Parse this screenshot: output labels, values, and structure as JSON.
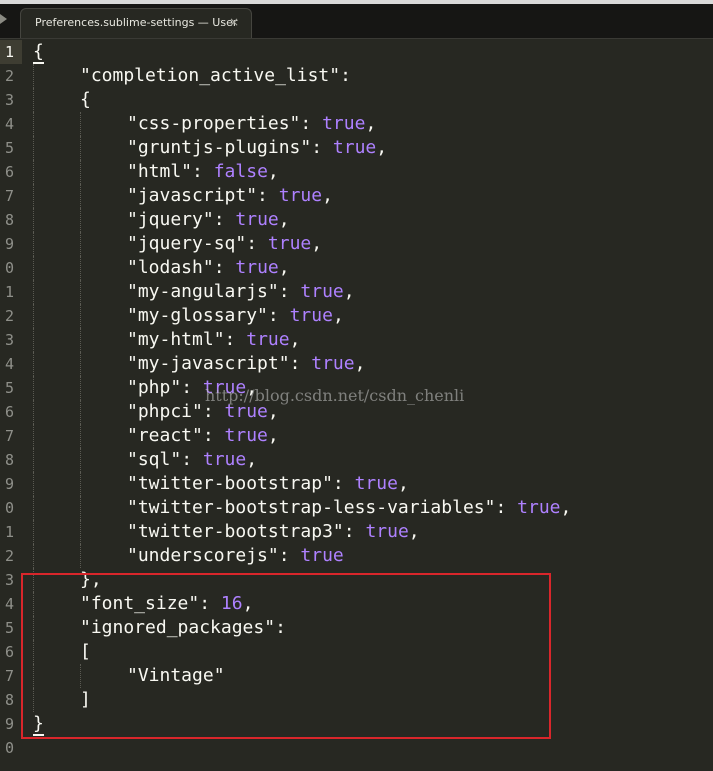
{
  "tab": {
    "title": "Preferences.sublime-settings — User",
    "close": "×"
  },
  "gutter": [
    "1",
    "2",
    "3",
    "4",
    "5",
    "6",
    "7",
    "8",
    "9",
    "0",
    "1",
    "2",
    "3",
    "4",
    "5",
    "6",
    "7",
    "8",
    "9",
    "0",
    "1",
    "2",
    "3",
    "4",
    "5",
    "6",
    "7",
    "8",
    "9",
    "0"
  ],
  "lines": [
    {
      "indent": 0,
      "tokens": [
        {
          "t": "{",
          "c": "punc bracket-hl"
        }
      ]
    },
    {
      "indent": 1,
      "tokens": [
        {
          "t": "\"completion_active_list\"",
          "c": "str"
        },
        {
          "t": ":",
          "c": "punc"
        }
      ]
    },
    {
      "indent": 1,
      "tokens": [
        {
          "t": "{",
          "c": "punc"
        }
      ]
    },
    {
      "indent": 2,
      "tokens": [
        {
          "t": "\"css-properties\"",
          "c": "str"
        },
        {
          "t": ": ",
          "c": "punc"
        },
        {
          "t": "true",
          "c": "bool"
        },
        {
          "t": ",",
          "c": "punc"
        }
      ]
    },
    {
      "indent": 2,
      "tokens": [
        {
          "t": "\"gruntjs-plugins\"",
          "c": "str"
        },
        {
          "t": ": ",
          "c": "punc"
        },
        {
          "t": "true",
          "c": "bool"
        },
        {
          "t": ",",
          "c": "punc"
        }
      ]
    },
    {
      "indent": 2,
      "tokens": [
        {
          "t": "\"html\"",
          "c": "str"
        },
        {
          "t": ": ",
          "c": "punc"
        },
        {
          "t": "false",
          "c": "bool"
        },
        {
          "t": ",",
          "c": "punc"
        }
      ]
    },
    {
      "indent": 2,
      "tokens": [
        {
          "t": "\"javascript\"",
          "c": "str"
        },
        {
          "t": ": ",
          "c": "punc"
        },
        {
          "t": "true",
          "c": "bool"
        },
        {
          "t": ",",
          "c": "punc"
        }
      ]
    },
    {
      "indent": 2,
      "tokens": [
        {
          "t": "\"jquery\"",
          "c": "str"
        },
        {
          "t": ": ",
          "c": "punc"
        },
        {
          "t": "true",
          "c": "bool"
        },
        {
          "t": ",",
          "c": "punc"
        }
      ]
    },
    {
      "indent": 2,
      "tokens": [
        {
          "t": "\"jquery-sq\"",
          "c": "str"
        },
        {
          "t": ": ",
          "c": "punc"
        },
        {
          "t": "true",
          "c": "bool"
        },
        {
          "t": ",",
          "c": "punc"
        }
      ]
    },
    {
      "indent": 2,
      "tokens": [
        {
          "t": "\"lodash\"",
          "c": "str"
        },
        {
          "t": ": ",
          "c": "punc"
        },
        {
          "t": "true",
          "c": "bool"
        },
        {
          "t": ",",
          "c": "punc"
        }
      ]
    },
    {
      "indent": 2,
      "tokens": [
        {
          "t": "\"my-angularjs\"",
          "c": "str"
        },
        {
          "t": ": ",
          "c": "punc"
        },
        {
          "t": "true",
          "c": "bool"
        },
        {
          "t": ",",
          "c": "punc"
        }
      ]
    },
    {
      "indent": 2,
      "tokens": [
        {
          "t": "\"my-glossary\"",
          "c": "str"
        },
        {
          "t": ": ",
          "c": "punc"
        },
        {
          "t": "true",
          "c": "bool"
        },
        {
          "t": ",",
          "c": "punc"
        }
      ]
    },
    {
      "indent": 2,
      "tokens": [
        {
          "t": "\"my-html\"",
          "c": "str"
        },
        {
          "t": ": ",
          "c": "punc"
        },
        {
          "t": "true",
          "c": "bool"
        },
        {
          "t": ",",
          "c": "punc"
        }
      ]
    },
    {
      "indent": 2,
      "tokens": [
        {
          "t": "\"my-javascript\"",
          "c": "str"
        },
        {
          "t": ": ",
          "c": "punc"
        },
        {
          "t": "true",
          "c": "bool"
        },
        {
          "t": ",",
          "c": "punc"
        }
      ]
    },
    {
      "indent": 2,
      "tokens": [
        {
          "t": "\"php\"",
          "c": "str"
        },
        {
          "t": ": ",
          "c": "punc"
        },
        {
          "t": "true",
          "c": "bool"
        },
        {
          "t": ",",
          "c": "punc"
        }
      ]
    },
    {
      "indent": 2,
      "tokens": [
        {
          "t": "\"phpci\"",
          "c": "str"
        },
        {
          "t": ": ",
          "c": "punc"
        },
        {
          "t": "true",
          "c": "bool"
        },
        {
          "t": ",",
          "c": "punc"
        }
      ]
    },
    {
      "indent": 2,
      "tokens": [
        {
          "t": "\"react\"",
          "c": "str"
        },
        {
          "t": ": ",
          "c": "punc"
        },
        {
          "t": "true",
          "c": "bool"
        },
        {
          "t": ",",
          "c": "punc"
        }
      ]
    },
    {
      "indent": 2,
      "tokens": [
        {
          "t": "\"sql\"",
          "c": "str"
        },
        {
          "t": ": ",
          "c": "punc"
        },
        {
          "t": "true",
          "c": "bool"
        },
        {
          "t": ",",
          "c": "punc"
        }
      ]
    },
    {
      "indent": 2,
      "tokens": [
        {
          "t": "\"twitter-bootstrap\"",
          "c": "str"
        },
        {
          "t": ": ",
          "c": "punc"
        },
        {
          "t": "true",
          "c": "bool"
        },
        {
          "t": ",",
          "c": "punc"
        }
      ]
    },
    {
      "indent": 2,
      "tokens": [
        {
          "t": "\"twitter-bootstrap-less-variables\"",
          "c": "str"
        },
        {
          "t": ": ",
          "c": "punc"
        },
        {
          "t": "true",
          "c": "bool"
        },
        {
          "t": ",",
          "c": "punc"
        }
      ]
    },
    {
      "indent": 2,
      "tokens": [
        {
          "t": "\"twitter-bootstrap3\"",
          "c": "str"
        },
        {
          "t": ": ",
          "c": "punc"
        },
        {
          "t": "true",
          "c": "bool"
        },
        {
          "t": ",",
          "c": "punc"
        }
      ]
    },
    {
      "indent": 2,
      "tokens": [
        {
          "t": "\"underscorejs\"",
          "c": "str"
        },
        {
          "t": ": ",
          "c": "punc"
        },
        {
          "t": "true",
          "c": "bool"
        }
      ]
    },
    {
      "indent": 1,
      "tokens": [
        {
          "t": "},",
          "c": "punc"
        }
      ]
    },
    {
      "indent": 1,
      "tokens": [
        {
          "t": "\"font_size\"",
          "c": "str"
        },
        {
          "t": ": ",
          "c": "punc"
        },
        {
          "t": "16",
          "c": "num"
        },
        {
          "t": ",",
          "c": "punc"
        }
      ]
    },
    {
      "indent": 1,
      "tokens": [
        {
          "t": "\"ignored_packages\"",
          "c": "str"
        },
        {
          "t": ":",
          "c": "punc"
        }
      ]
    },
    {
      "indent": 1,
      "tokens": [
        {
          "t": "[",
          "c": "punc"
        }
      ]
    },
    {
      "indent": 2,
      "tokens": [
        {
          "t": "\"Vintage\"",
          "c": "str"
        }
      ]
    },
    {
      "indent": 1,
      "tokens": [
        {
          "t": "]",
          "c": "punc"
        }
      ]
    },
    {
      "indent": 0,
      "tokens": [
        {
          "t": "}",
          "c": "punc bracket-hl"
        }
      ]
    },
    {
      "indent": 0,
      "tokens": []
    }
  ],
  "watermark": "http://blog.csdn.net/csdn_chenli",
  "colors": {
    "background": "#272822",
    "keyword": "#ae81ff",
    "text": "#f8f8f2",
    "highlight_box": "#d9262b"
  }
}
